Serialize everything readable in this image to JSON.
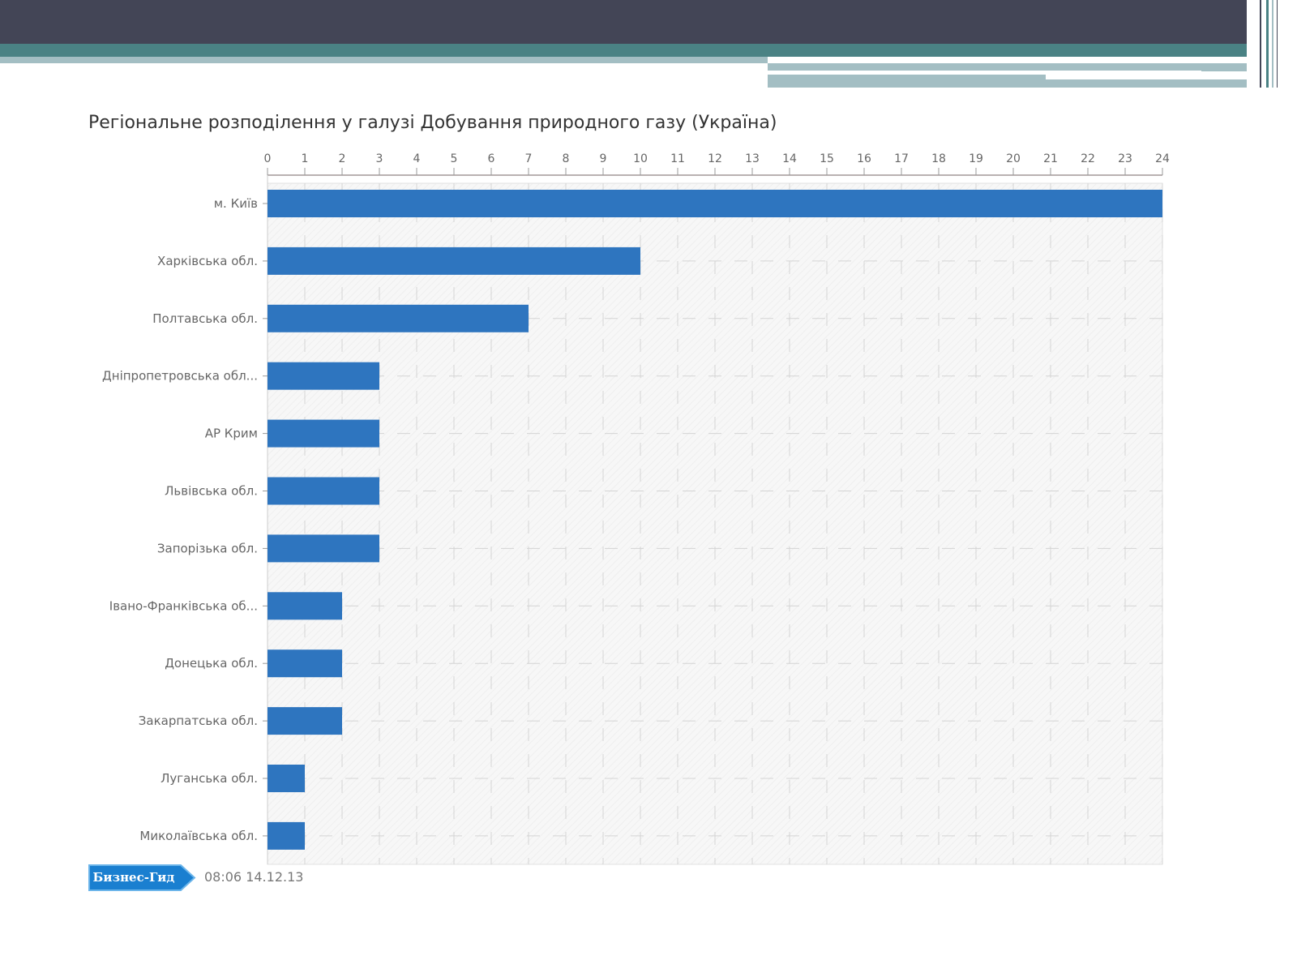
{
  "colors": {
    "header_dark": "#434556",
    "header_teal": "#4a8284",
    "header_light": "#a3bec3",
    "bar": "#2e75bf",
    "plot_bg": "#f5f5f5",
    "logo_bg": "#1a7fd0"
  },
  "footer": {
    "logo_text": "Бизнес-Гид",
    "timestamp": "08:06 14.12.13"
  },
  "chart_data": {
    "type": "bar",
    "orientation": "horizontal",
    "title": "Регіональне розподілення у галузі Добування природного газу (Україна)",
    "xlim": [
      0,
      24
    ],
    "x_ticks": [
      0,
      1,
      2,
      3,
      4,
      5,
      6,
      7,
      8,
      9,
      10,
      11,
      12,
      13,
      14,
      15,
      16,
      17,
      18,
      19,
      20,
      21,
      22,
      23,
      24
    ],
    "axis_position": "top",
    "grid": true,
    "categories": [
      "м. Київ",
      "Харківська обл.",
      "Полтавська обл.",
      "Дніпропетровська обл...",
      "АР Крим",
      "Львівська обл.",
      "Запорізька обл.",
      "Івано-Франківська об...",
      "Донецька обл.",
      "Закарпатська обл.",
      "Луганська обл.",
      "Миколаївська обл."
    ],
    "values": [
      24,
      10,
      7,
      3,
      3,
      3,
      3,
      2,
      2,
      2,
      1,
      1
    ]
  }
}
